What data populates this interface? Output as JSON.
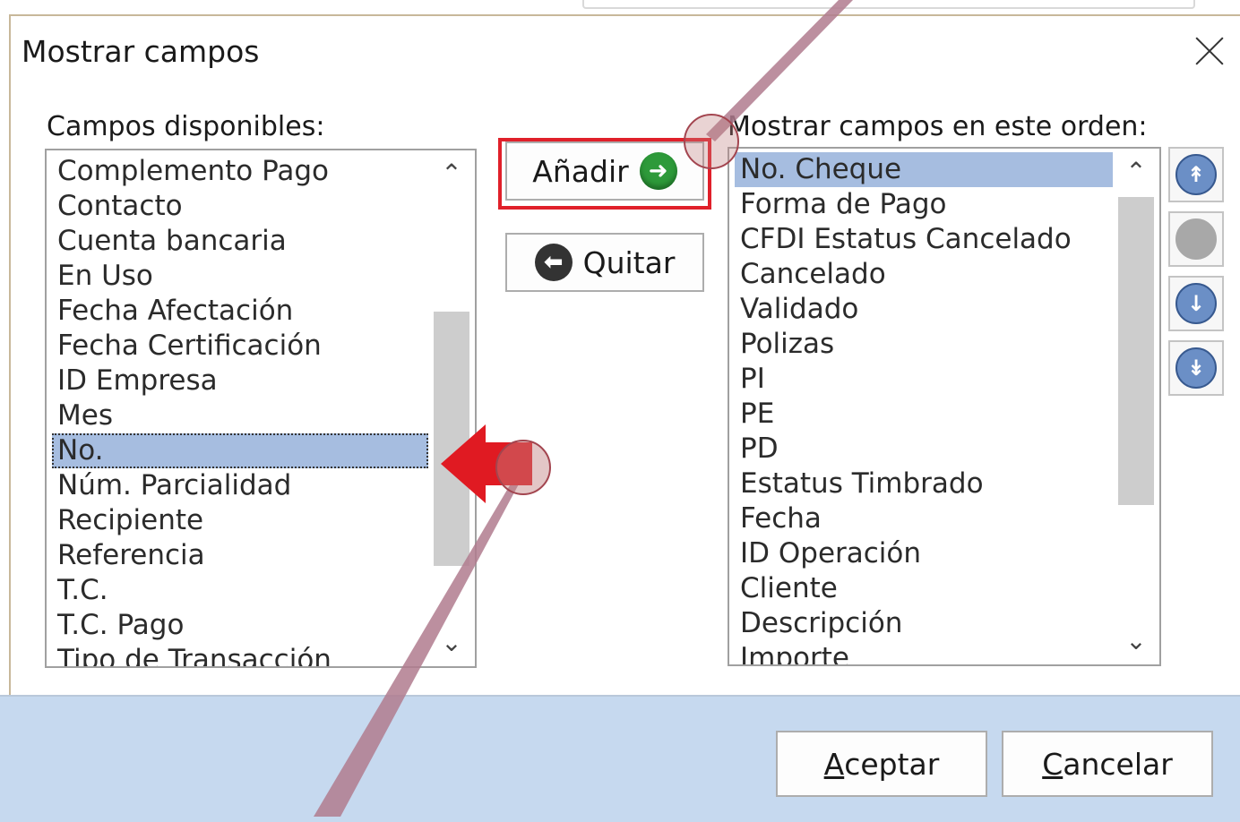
{
  "dialog": {
    "title": "Mostrar campos",
    "available_label": "Campos disponibles:",
    "ordered_label": "Mostrar campos en este orden:"
  },
  "available_fields": [
    "Complemento Pago",
    "Contacto",
    "Cuenta bancaria",
    "En Uso",
    "Fecha Afectación",
    "Fecha Certificación",
    "ID Empresa",
    "Mes",
    "No.",
    "Núm. Parcialidad",
    "Recipiente",
    "Referencia",
    "T.C.",
    "T.C. Pago",
    "Tipo de Transacción"
  ],
  "available_selected": "No.",
  "shown_fields": [
    "No. Cheque",
    "Forma de Pago",
    "CFDI Estatus Cancelado",
    "Cancelado",
    "Validado",
    "Polizas",
    "PI",
    "PE",
    "PD",
    "Estatus Timbrado",
    "Fecha",
    "ID Operación",
    "Cliente",
    "Descripción",
    "Importe"
  ],
  "shown_selected": "No. Cheque",
  "buttons": {
    "add": "Añadir",
    "remove": "Quitar",
    "accept_key": "A",
    "accept_rest": "ceptar",
    "cancel_key": "C",
    "cancel_rest": "ancelar"
  },
  "icons": {
    "add": "arrow-right-circle-icon",
    "remove": "arrow-left-circle-icon",
    "move_top": "move-to-top-icon",
    "move_up": "move-up-icon",
    "move_down": "move-down-icon",
    "move_bottom": "move-to-bottom-icon",
    "close": "close-icon"
  },
  "colors": {
    "selection": "#a6bde0",
    "footer": "#c6d9ef",
    "highlight": "#e0202a"
  }
}
